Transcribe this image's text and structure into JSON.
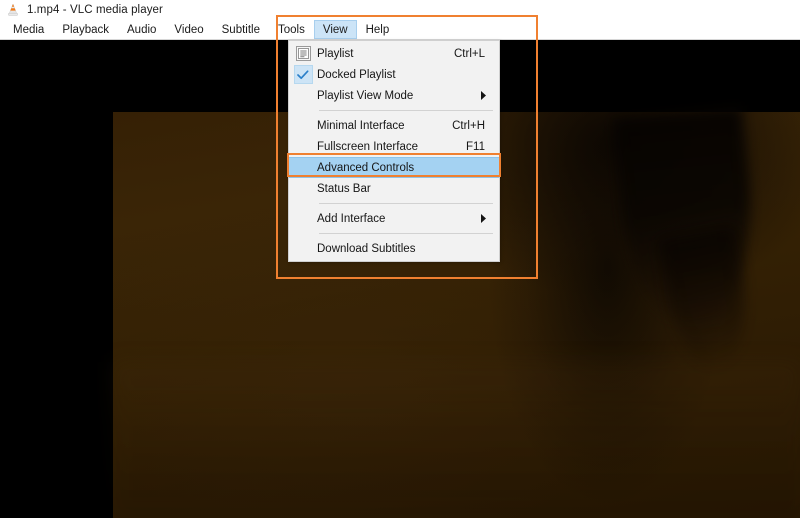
{
  "window": {
    "title": "1.mp4 - VLC media player",
    "app_icon": "vlc-cone-icon"
  },
  "menubar": {
    "items": [
      {
        "label": "Media",
        "active": false
      },
      {
        "label": "Playback",
        "active": false
      },
      {
        "label": "Audio",
        "active": false
      },
      {
        "label": "Video",
        "active": false
      },
      {
        "label": "Subtitle",
        "active": false
      },
      {
        "label": "Tools",
        "active": false
      },
      {
        "label": "View",
        "active": true
      },
      {
        "label": "Help",
        "active": false
      }
    ]
  },
  "view_menu": {
    "items": [
      {
        "label": "Playlist",
        "accel": "Ctrl+L",
        "icon": "playlist-icon",
        "arrow": false,
        "selected": false
      },
      {
        "label": "Docked Playlist",
        "accel": "",
        "icon": "check-icon",
        "arrow": false,
        "selected": false
      },
      {
        "label": "Playlist View Mode",
        "accel": "",
        "icon": "",
        "arrow": true,
        "selected": false
      },
      {
        "label": "Minimal Interface",
        "accel": "Ctrl+H",
        "icon": "",
        "arrow": false,
        "selected": false
      },
      {
        "label": "Fullscreen Interface",
        "accel": "F11",
        "icon": "",
        "arrow": false,
        "selected": false
      },
      {
        "label": "Advanced Controls",
        "accel": "",
        "icon": "",
        "arrow": false,
        "selected": true
      },
      {
        "label": "Status Bar",
        "accel": "",
        "icon": "",
        "arrow": false,
        "selected": false
      },
      {
        "label": "Add Interface",
        "accel": "",
        "icon": "",
        "arrow": true,
        "selected": false
      },
      {
        "label": "Download Subtitles",
        "accel": "",
        "icon": "",
        "arrow": false,
        "selected": false
      }
    ],
    "separators_after": [
      2,
      6,
      7
    ]
  },
  "annotations": {
    "menu_box_color": "#f08030",
    "item_box_color": "#f08030"
  },
  "colors": {
    "menu_highlight": "#a4d2f2",
    "menubar_highlight": "#cce4f7",
    "menu_background": "#f2f2f2",
    "video_letterbox": "#000000",
    "video_tint": "#352005",
    "accent_orange": "#f08030"
  },
  "video": {
    "description": "dark brown video frame with black letterbox borders"
  }
}
